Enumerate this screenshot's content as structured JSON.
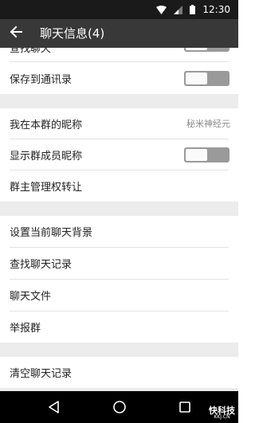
{
  "status_bar": {
    "time": "12:30"
  },
  "toolbar": {
    "title": "聊天信息(4)"
  },
  "settings": {
    "find_chat_partial": "查找聊天",
    "save_to_contacts": "保存到通讯录",
    "my_group_nickname": "我在本群的昵称",
    "my_group_nickname_value": "秘米神经元",
    "show_member_nicknames": "显示群成员昵称",
    "transfer_ownership": "群主管理权转让",
    "set_background": "设置当前聊天背景",
    "search_history": "查找聊天记录",
    "chat_files": "聊天文件",
    "report_group": "举报群",
    "clear_history": "清空聊天记录"
  },
  "toggles": {
    "save_to_contacts": false,
    "show_member_nicknames": false
  },
  "watermark": {
    "brand": "快科技",
    "domain": "KKJ.CN"
  }
}
